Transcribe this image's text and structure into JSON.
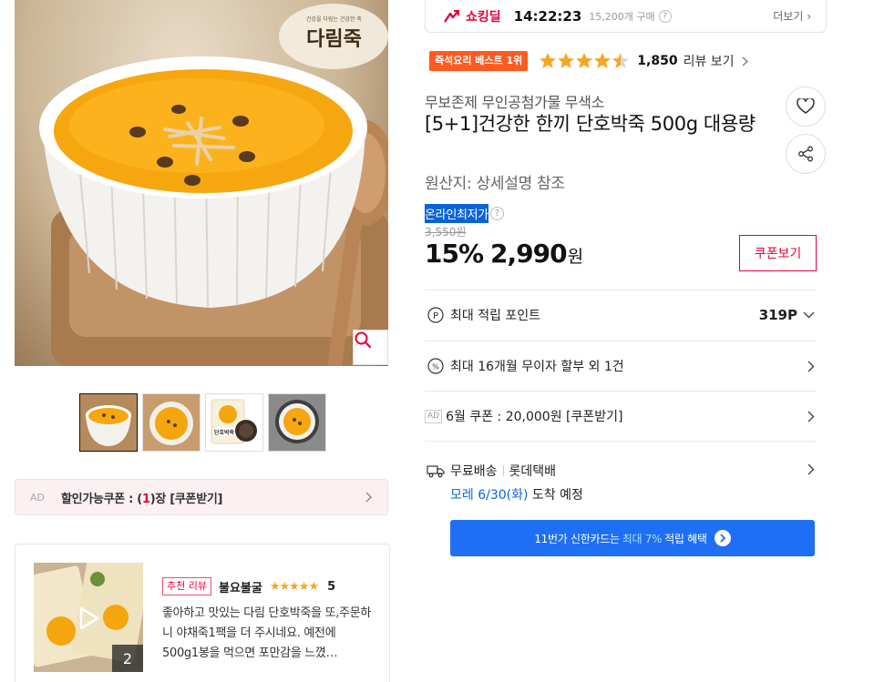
{
  "deal": {
    "label": "쇼킹딜",
    "timer": "14:22:23",
    "bought": "15,200개 구매",
    "more": "더보기"
  },
  "product": {
    "image_brand_text": "다림죽",
    "image_brand_small": "건강을 다림는 건강한 죽",
    "best_badge": "즉석요리 베스트 1위",
    "rating": 4.5,
    "review_count": "1,850",
    "review_link": "리뷰 보기",
    "brand_line": "무보존제 무인공첨가물 무색소",
    "title": "[5+1]건강한 한끼 단호박죽 500g 대용량",
    "origin": "원산지: 상세설명 참조",
    "lowest_label": "온라인최저가",
    "original_price": "3,550원",
    "discount": "15%",
    "price": "2,990",
    "price_unit": "원",
    "coupon_button": "쿠폰보기"
  },
  "thumbnails": [
    {
      "name": "thumb-1"
    },
    {
      "name": "thumb-2"
    },
    {
      "name": "thumb-3",
      "label": "단호박죽"
    },
    {
      "name": "thumb-4"
    }
  ],
  "coupon_bar": {
    "ad": "AD",
    "prefix": "할인가능쿠폰 : (",
    "count": "1",
    "suffix": ")장 [쿠폰받기]"
  },
  "info_rows": {
    "points": {
      "label": "최대 적립 포인트",
      "value": "319P"
    },
    "installment": {
      "label": "최대 16개월 무이자 할부 외 1건"
    },
    "ad_coupon": {
      "ad": "AD",
      "label": "6월 쿠폰 : 20,000원 [쿠폰받기]"
    }
  },
  "shipping": {
    "free": "무료배송",
    "carrier": "롯데택배",
    "date": "모레 6/30(화)",
    "arrival": "도착 예정"
  },
  "card_banner": {
    "prefix": "11번가 신한카드는",
    "highlight": "최대 7%",
    "suffix": "적립 혜택"
  },
  "review": {
    "badge": "추천 리뷰",
    "user": "불요불굴",
    "stars": "★★★★★",
    "score": "5",
    "image_count": "2",
    "text": "좋아하고 맛있는 다림 단호박죽을 또,주문하니 야채죽1팩을 더 주시네요. 예전에 500g1봉을 먹으면 포만감을 느꼈…"
  },
  "colors": {
    "accent_red": "#e5003e",
    "best_orange": "#ff5a1f",
    "star": "#f5a623",
    "blue": "#1f6ff5",
    "select_blue": "#0a64d8"
  }
}
